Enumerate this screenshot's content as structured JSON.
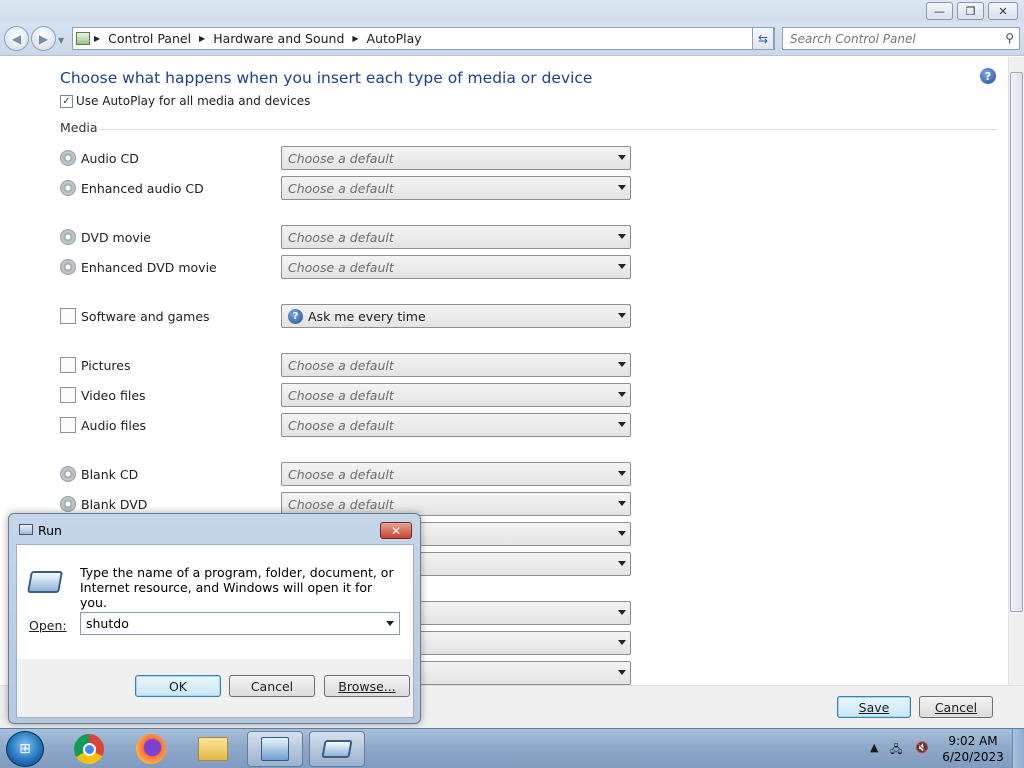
{
  "window": {
    "minimize_glyph": "—",
    "restore_glyph": "❐",
    "close_glyph": "✕"
  },
  "nav": {
    "back_icon": "back-arrow-icon",
    "forward_icon": "forward-arrow-icon",
    "breadcrumbs": [
      "Control Panel",
      "Hardware and Sound",
      "AutoPlay"
    ],
    "search_placeholder": "Search Control Panel"
  },
  "page": {
    "heading": "Choose what happens when you insert each type of media or device",
    "use_autoplay_label": "Use AutoPlay for all media and devices",
    "use_autoplay_checked": true,
    "section_media": "Media"
  },
  "media_rows": [
    {
      "label": "Audio CD",
      "value": "Choose a default",
      "icon": "audio-cd-icon"
    },
    {
      "label": "Enhanced audio CD",
      "value": "Choose a default",
      "icon": "enhanced-audio-cd-icon"
    },
    {
      "label": "DVD movie",
      "value": "Choose a default",
      "icon": "dvd-movie-icon"
    },
    {
      "label": "Enhanced DVD movie",
      "value": "Choose a default",
      "icon": "enhanced-dvd-movie-icon"
    },
    {
      "label": "Software and games",
      "value": "Ask me every time",
      "icon": "software-games-icon"
    },
    {
      "label": "Pictures",
      "value": "Choose a default",
      "icon": "pictures-icon"
    },
    {
      "label": "Video files",
      "value": "Choose a default",
      "icon": "video-files-icon"
    },
    {
      "label": "Audio files",
      "value": "Choose a default",
      "icon": "audio-files-icon"
    },
    {
      "label": "Blank CD",
      "value": "Choose a default",
      "icon": "blank-cd-icon"
    },
    {
      "label": "Blank DVD",
      "value": "Choose a default",
      "icon": "blank-dvd-icon"
    }
  ],
  "footer": {
    "save_label": "Save",
    "cancel_label": "Cancel"
  },
  "run_dialog": {
    "title": "Run",
    "close_glyph": "✕",
    "description": "Type the name of a program, folder, document, or Internet resource, and Windows will open it for you.",
    "open_label": "Open:",
    "open_value": "shutdo",
    "ok_label": "OK",
    "cancel_label": "Cancel",
    "browse_label": "Browse..."
  },
  "taskbar": {
    "apps": [
      "chrome-icon",
      "firefox-icon",
      "file-explorer-icon",
      "control-panel-icon",
      "run-icon"
    ],
    "time": "9:02 AM",
    "date": "6/20/2023"
  }
}
